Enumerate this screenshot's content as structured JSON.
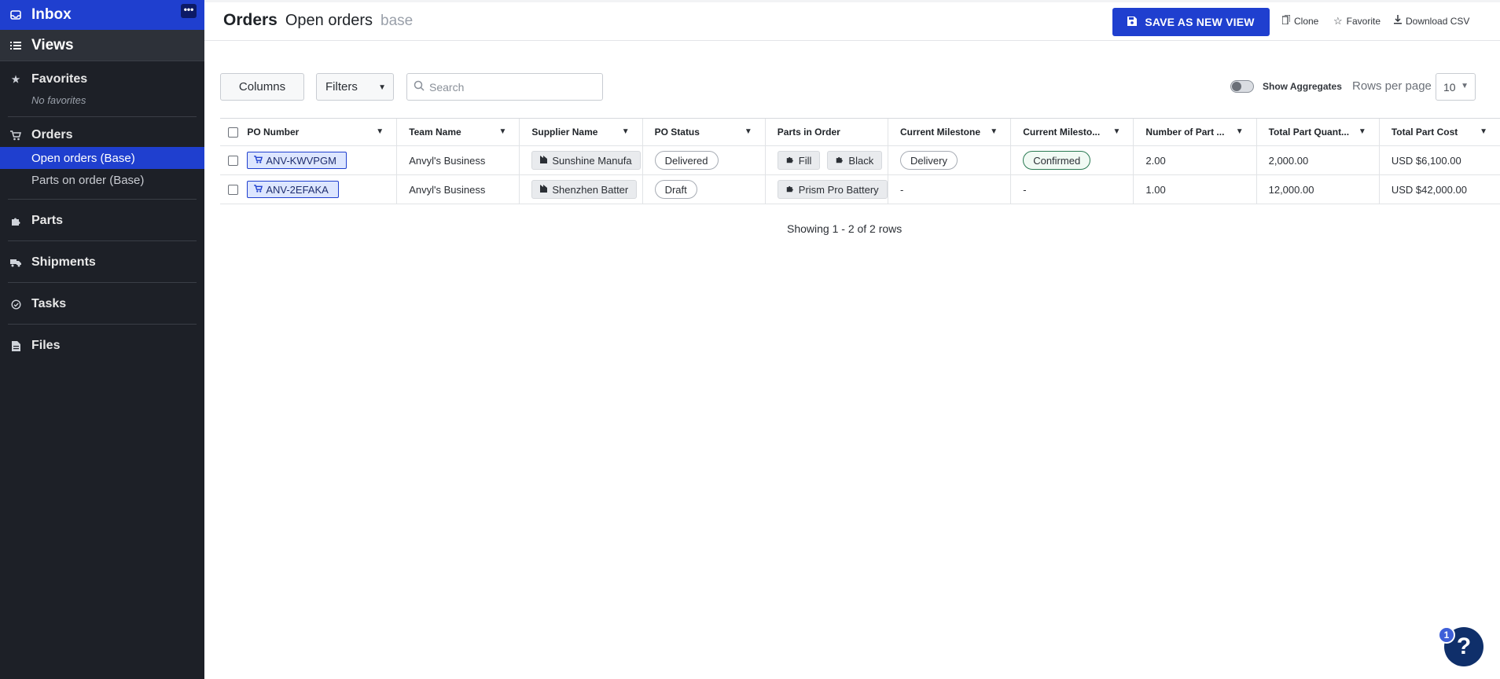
{
  "sidebar": {
    "inbox_label": "Inbox",
    "views_label": "Views",
    "favorites_label": "Favorites",
    "favorites_empty": "No favorites",
    "orders_label": "Orders",
    "orders_items": [
      "Open orders (Base)",
      "Parts on order (Base)"
    ],
    "more_label": "•••",
    "parts_label": "Parts",
    "shipments_label": "Shipments",
    "tasks_label": "Tasks",
    "files_label": "Files"
  },
  "header": {
    "breadcrumb_section": "Orders",
    "breadcrumb_view": "Open orders",
    "breadcrumb_suffix": "base",
    "save_button": "SAVE AS NEW VIEW",
    "clone_label": "Clone",
    "favorite_label": "Favorite",
    "download_label": "Download CSV"
  },
  "toolbar": {
    "columns_label": "Columns",
    "filters_label": "Filters",
    "search_placeholder": "Search",
    "show_aggregates_label": "Show Aggregates",
    "show_aggregates_on": false,
    "rows_per_page_label": "Rows per page",
    "rows_per_page_value": "10"
  },
  "table": {
    "headers": [
      "PO Number",
      "Team Name",
      "Supplier Name",
      "PO Status",
      "Parts in Order",
      "Current Milestone",
      "Current Milesto...",
      "Number of Part ...",
      "Total Part Quant...",
      "Total Part Cost"
    ],
    "rows": [
      {
        "po": "ANV-KWVPGM",
        "team": "Anvyl's Business",
        "supplier": "Sunshine Manufa",
        "status": "Delivered",
        "parts": [
          "Fill",
          "Black"
        ],
        "milestone": "Delivery",
        "milestone_status": "Confirmed",
        "num_parts": "2.00",
        "total_qty": "2,000.00",
        "total_cost": "USD $6,100.00"
      },
      {
        "po": "ANV-2EFAKA",
        "team": "Anvyl's Business",
        "supplier": "Shenzhen Batter",
        "status": "Draft",
        "parts": [
          "Prism Pro Battery"
        ],
        "milestone": "-",
        "milestone_status": "-",
        "num_parts": "1.00",
        "total_qty": "12,000.00",
        "total_cost": "USD $42,000.00"
      }
    ],
    "showing_text": "Showing 1 - 2 of 2 rows"
  },
  "help": {
    "badge_count": "1",
    "label": "?"
  },
  "colors": {
    "accent": "#1f3fcf",
    "sidebar_bg": "#1d2027",
    "confirmed_border": "#2a7a53"
  }
}
